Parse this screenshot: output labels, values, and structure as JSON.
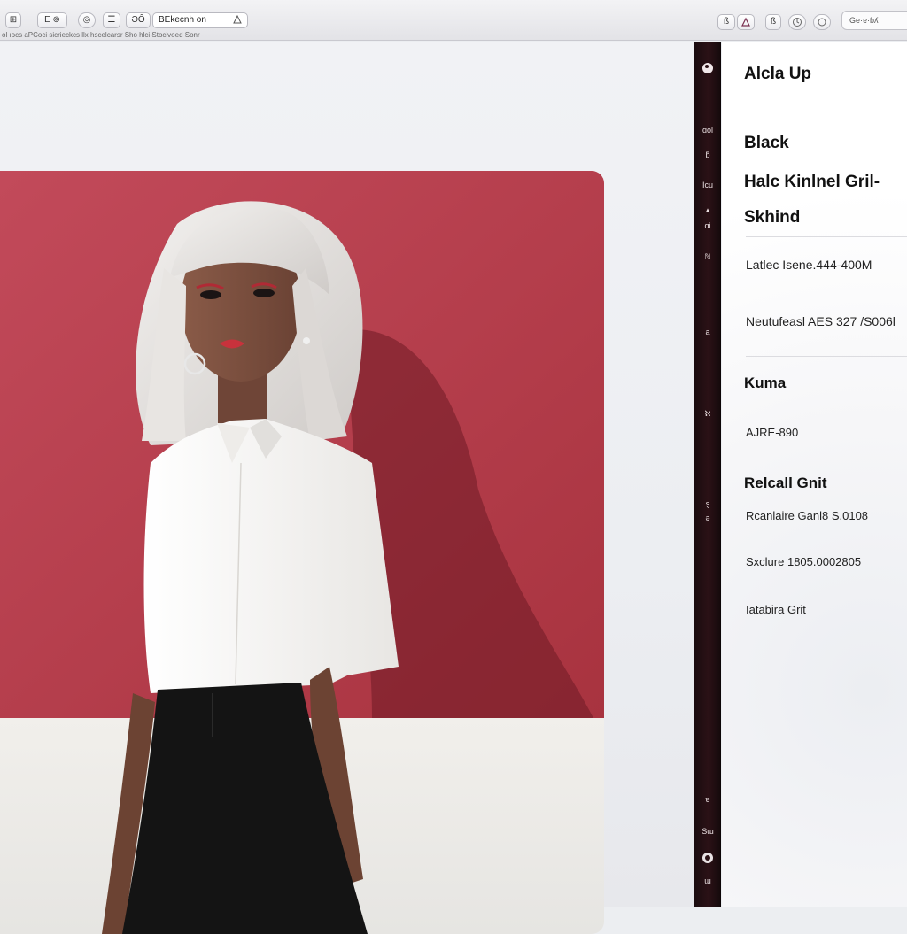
{
  "toolbar": {
    "view_label": "⊞",
    "nav_label": "E ⊚",
    "reload_label": "◎",
    "list_label": "☰",
    "zoom_label": "ƏÔ",
    "address_text": "BEkecnh on",
    "search_text": "Ge·ɐ·ɓʎ",
    "bookmarks_text": "ol ıocs aPCoci  sicrieckcs llx hscelcarsr  Sho  hlci Stocivoed  Sonr",
    "right_btn_1": "ß",
    "right_btn_2": "ß"
  },
  "rail": {
    "items": [
      "ɑol",
      "ƃ",
      "Icu",
      "▴",
      "ɑi",
      "ℕ",
      "ą",
      "ℵ",
      "ȿ",
      "ǝ",
      "ɐ",
      "Sɯ",
      "ɯ"
    ]
  },
  "detail": {
    "heading": "Alcla Up",
    "title_1": "Black",
    "title_2": "Halc Kinlnel Gril-",
    "title_3": "Skhind",
    "meta_1": "Latlec Isene.444-400M",
    "meta_2": "Neutufeasl AES 327 /S006l",
    "section_1": "Kuma",
    "value_1": "AJRE-890",
    "section_2": "Relcall Gnit",
    "value_2": "Rcanlaire Ganl8 S.0108",
    "value_3": "Sxclure 1805.0002805",
    "value_4": "Iatabira Grit"
  },
  "colors": {
    "backdrop_red": "#b7404e",
    "rail_dark": "#2b1116",
    "shirt_white": "#f6f5f3",
    "hair_silver": "#e4e2e0"
  }
}
